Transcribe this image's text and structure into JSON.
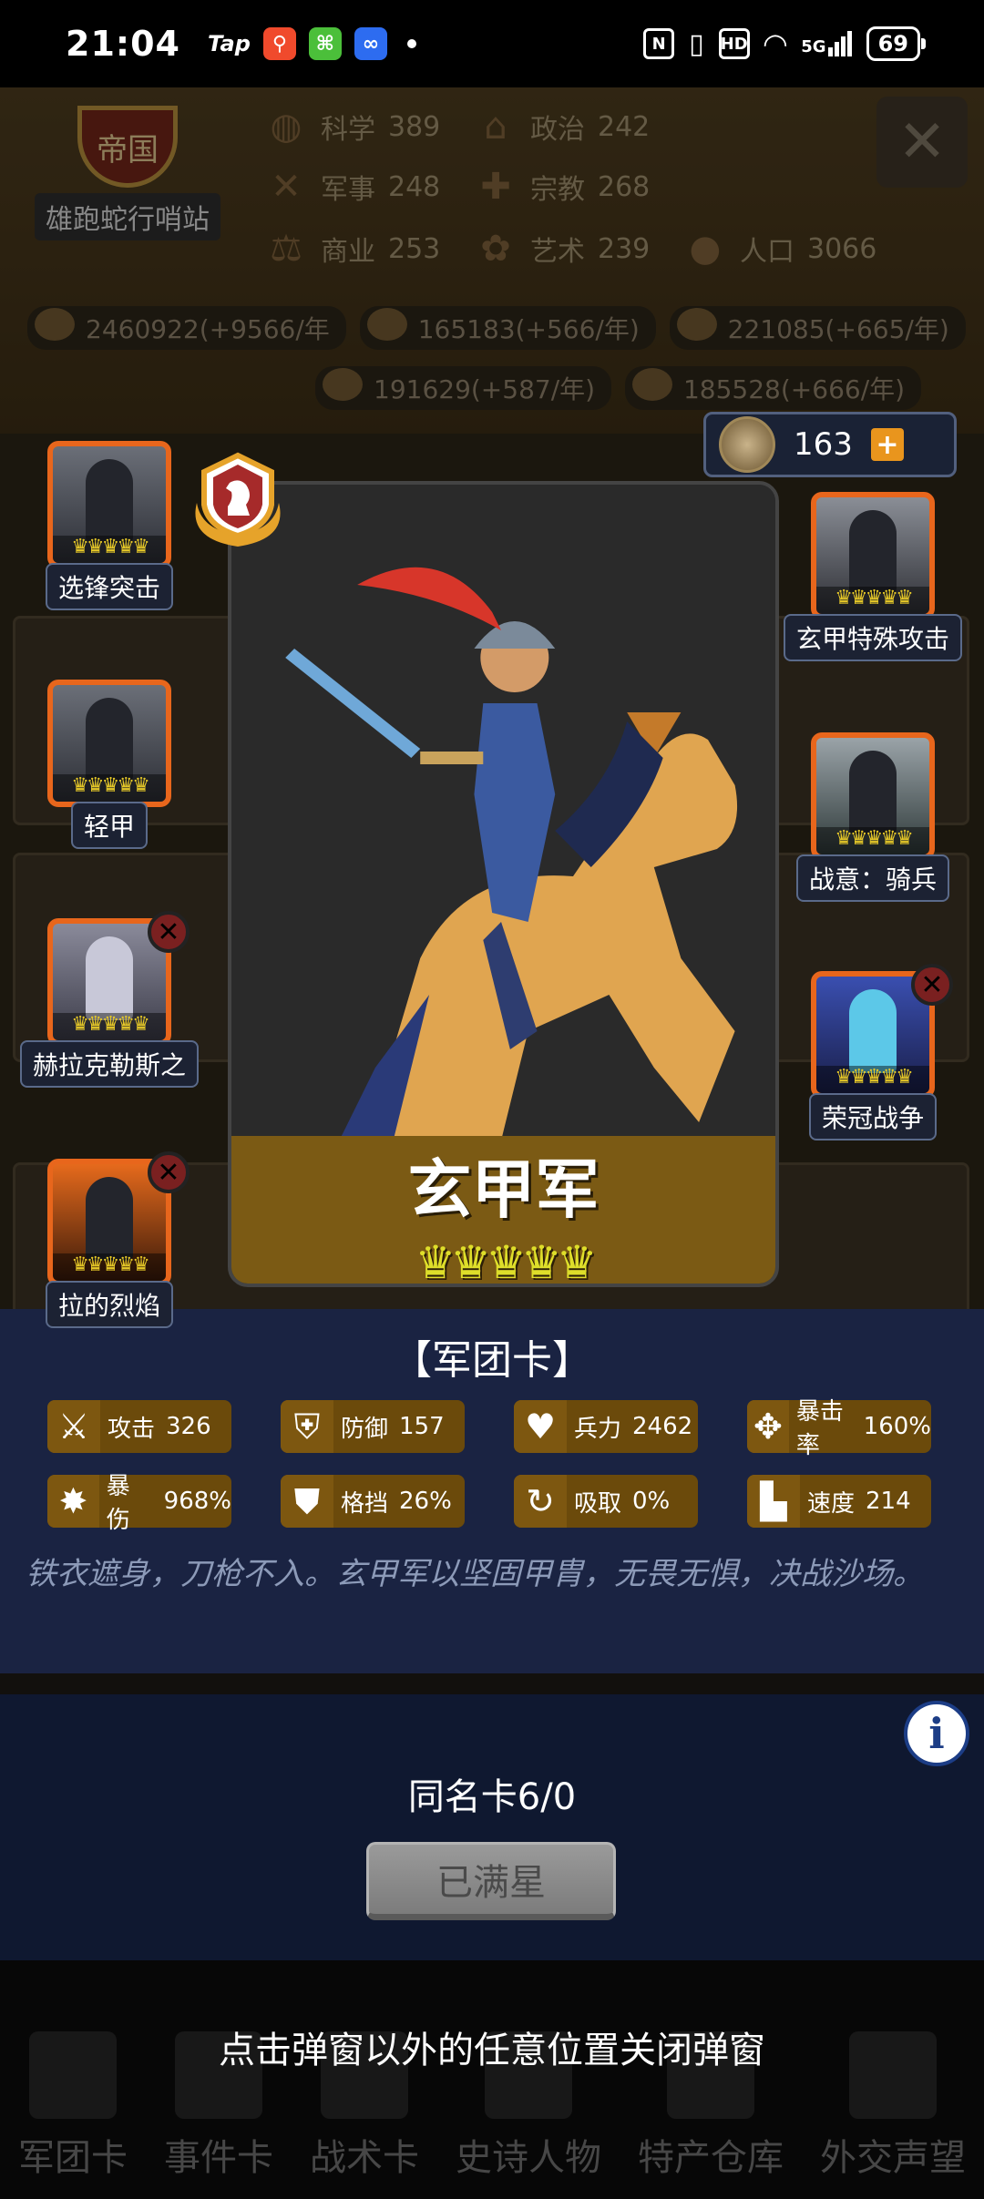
{
  "status_bar": {
    "time": "21:04",
    "apps": [
      {
        "icon": "taptap-icon",
        "label": "Tap"
      },
      {
        "icon": "app-orange-icon",
        "label": "",
        "color": "#f04a2c"
      },
      {
        "icon": "app-green-icon",
        "label": "",
        "color": "#4bbf3a"
      },
      {
        "icon": "app-blue-icon",
        "label": "",
        "color": "#2d6cf0"
      }
    ],
    "signal_label": "5G",
    "hd_label": "HD",
    "battery": "69"
  },
  "background": {
    "empire_badge": "帝国",
    "empire_name": "雄跑蛇行哨站",
    "stats": [
      {
        "icon": "planet-icon",
        "label": "科学",
        "value": "389"
      },
      {
        "icon": "building-icon",
        "label": "政治",
        "value": "242"
      },
      {
        "icon": "swords-icon",
        "label": "军事",
        "value": "248"
      },
      {
        "icon": "cross-icon",
        "label": "宗教",
        "value": "268"
      },
      {
        "icon": "scales-icon",
        "label": "商业",
        "value": "253"
      },
      {
        "icon": "lotus-icon",
        "label": "艺术",
        "value": "239"
      },
      {
        "icon": "person-icon",
        "label": "人口",
        "value": "3066"
      }
    ],
    "resources": [
      "2460922(+9566/年",
      "165183(+566/年)",
      "221085(+665/年)",
      "191629(+587/年)",
      "185528(+666/年)"
    ],
    "bottom_nav": [
      "军团卡",
      "事件卡",
      "战术卡",
      "史诗人物",
      "特产仓库",
      "外交声望"
    ]
  },
  "coins": {
    "value": "163",
    "plus": "+"
  },
  "left_skills": [
    {
      "label": "选锋突击",
      "has_remove": false
    },
    {
      "label": "轻甲",
      "has_remove": false
    },
    {
      "label": "赫拉克勒斯之",
      "has_remove": true
    },
    {
      "label": "拉的烈焰",
      "has_remove": true
    }
  ],
  "right_skills": [
    {
      "label": "玄甲特殊攻击",
      "has_remove": false
    },
    {
      "label": "战意：骑兵",
      "has_remove": false
    },
    {
      "label": "荣冠战争",
      "has_remove": true
    }
  ],
  "crowns_small": "♛♛♛♛♛",
  "card": {
    "name": "玄甲军",
    "crowns": "♛♛♛♛♛",
    "colors": {
      "band": "#7b5a14",
      "crown": "#dede2a"
    }
  },
  "info": {
    "title": "【军团卡】",
    "stats": [
      {
        "icon": "sword-icon",
        "label": "攻击",
        "value": "326"
      },
      {
        "icon": "shield-icon",
        "label": "防御",
        "value": "157"
      },
      {
        "icon": "heart-icon",
        "label": "兵力",
        "value": "2462"
      },
      {
        "icon": "crit-icon",
        "label": "暴击率",
        "value": "160%"
      },
      {
        "icon": "burst-icon",
        "label": "暴伤",
        "value": "968%"
      },
      {
        "icon": "block-icon",
        "label": "格挡",
        "value": "26%"
      },
      {
        "icon": "drain-icon",
        "label": "吸取",
        "value": "0%"
      },
      {
        "icon": "boot-icon",
        "label": "速度",
        "value": "214"
      }
    ],
    "description": "铁衣遮身，刀枪不入。玄甲军以坚固甲胄，无畏无惧，决战沙场。"
  },
  "duplicate_count": "同名卡6/0",
  "star_button": "已满星",
  "close_hint": "点击弹窗以外的任意位置关闭弹窗"
}
